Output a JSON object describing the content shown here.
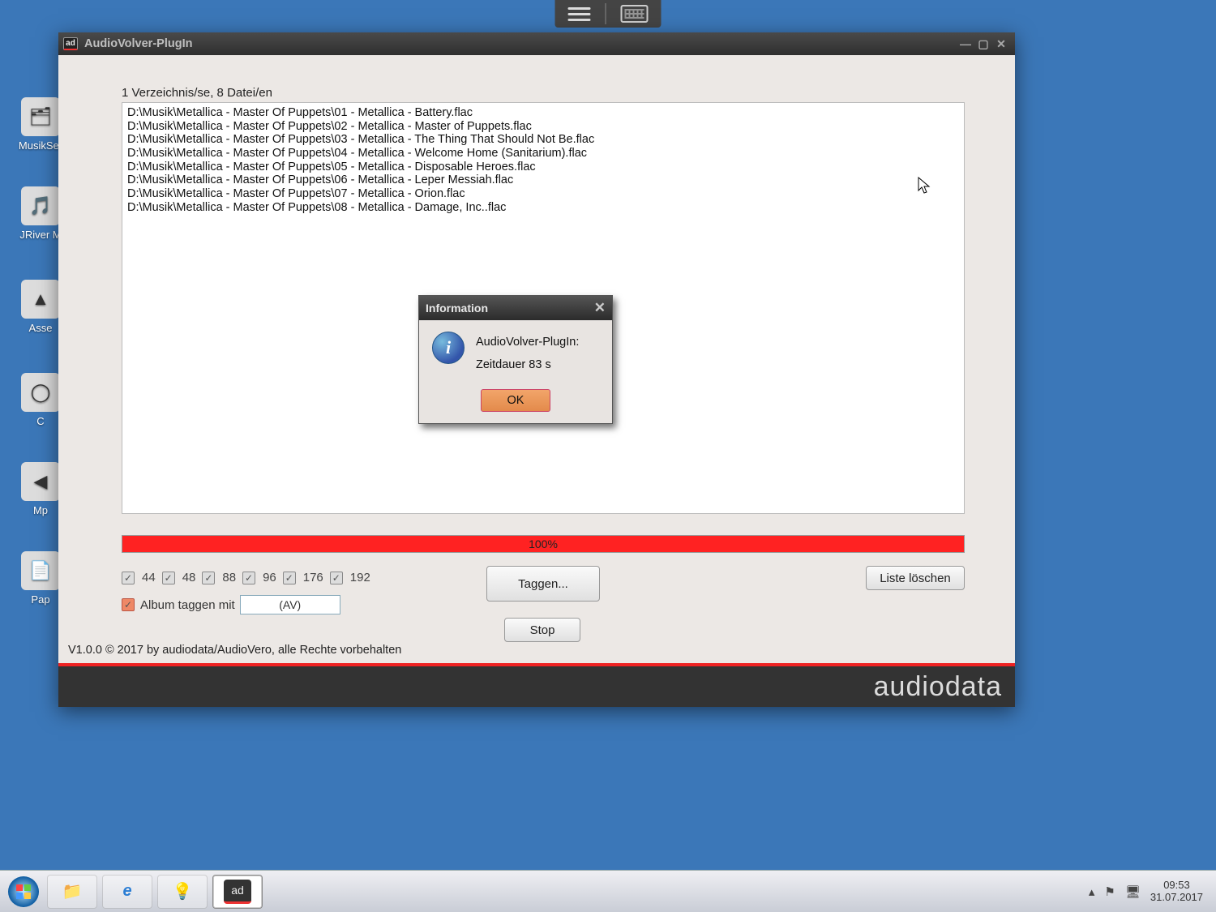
{
  "top_tray": {
    "hamburger": "menu-icon",
    "keyboard": "keyboard-icon"
  },
  "desktop": {
    "icons": [
      {
        "label": "MusikSer"
      },
      {
        "label": "JRiver M"
      },
      {
        "label": "Asse"
      },
      {
        "label": "C"
      },
      {
        "label": "Mp"
      },
      {
        "label": "Pap"
      }
    ]
  },
  "window": {
    "title": "AudioVolver-PlugIn",
    "badge": "ad",
    "summary": "1 Verzeichnis/se, 8 Datei/en",
    "files": [
      "D:\\Musik\\Metallica - Master Of Puppets\\01 - Metallica - Battery.flac",
      "D:\\Musik\\Metallica - Master Of Puppets\\02 - Metallica - Master of Puppets.flac",
      "D:\\Musik\\Metallica - Master Of Puppets\\03 - Metallica - The Thing That Should Not Be.flac",
      "D:\\Musik\\Metallica - Master Of Puppets\\04 - Metallica - Welcome Home (Sanitarium).flac",
      "D:\\Musik\\Metallica - Master Of Puppets\\05 - Metallica - Disposable Heroes.flac",
      "D:\\Musik\\Metallica - Master Of Puppets\\06 - Metallica - Leper Messiah.flac",
      "D:\\Musik\\Metallica - Master Of Puppets\\07 - Metallica - Orion.flac",
      "D:\\Musik\\Metallica - Master Of Puppets\\08 - Metallica - Damage, Inc..flac"
    ],
    "progress_text": "100%",
    "sample_rates": {
      "r44": "44",
      "r48": "48",
      "r88": "88",
      "r96": "96",
      "r176": "176",
      "r192": "192"
    },
    "album_tag_label": "Album taggen mit",
    "album_tag_value": "(AV)",
    "buttons": {
      "taggen": "Taggen...",
      "stop": "Stop",
      "liste": "Liste löschen"
    },
    "footer": "V1.0.0 © 2017 by audiodata/AudioVero, alle Rechte vorbehalten",
    "brand": "audiodata"
  },
  "modal": {
    "title": "Information",
    "line1": "AudioVolver-PlugIn:",
    "line2": "Zeitdauer 83 s",
    "ok": "OK"
  },
  "taskbar": {
    "apps": {
      "explorer": "explorer",
      "ie": "ie",
      "bulb": "bulb",
      "ad": "ad"
    },
    "time": "09:53",
    "date": "31.07.2017"
  }
}
